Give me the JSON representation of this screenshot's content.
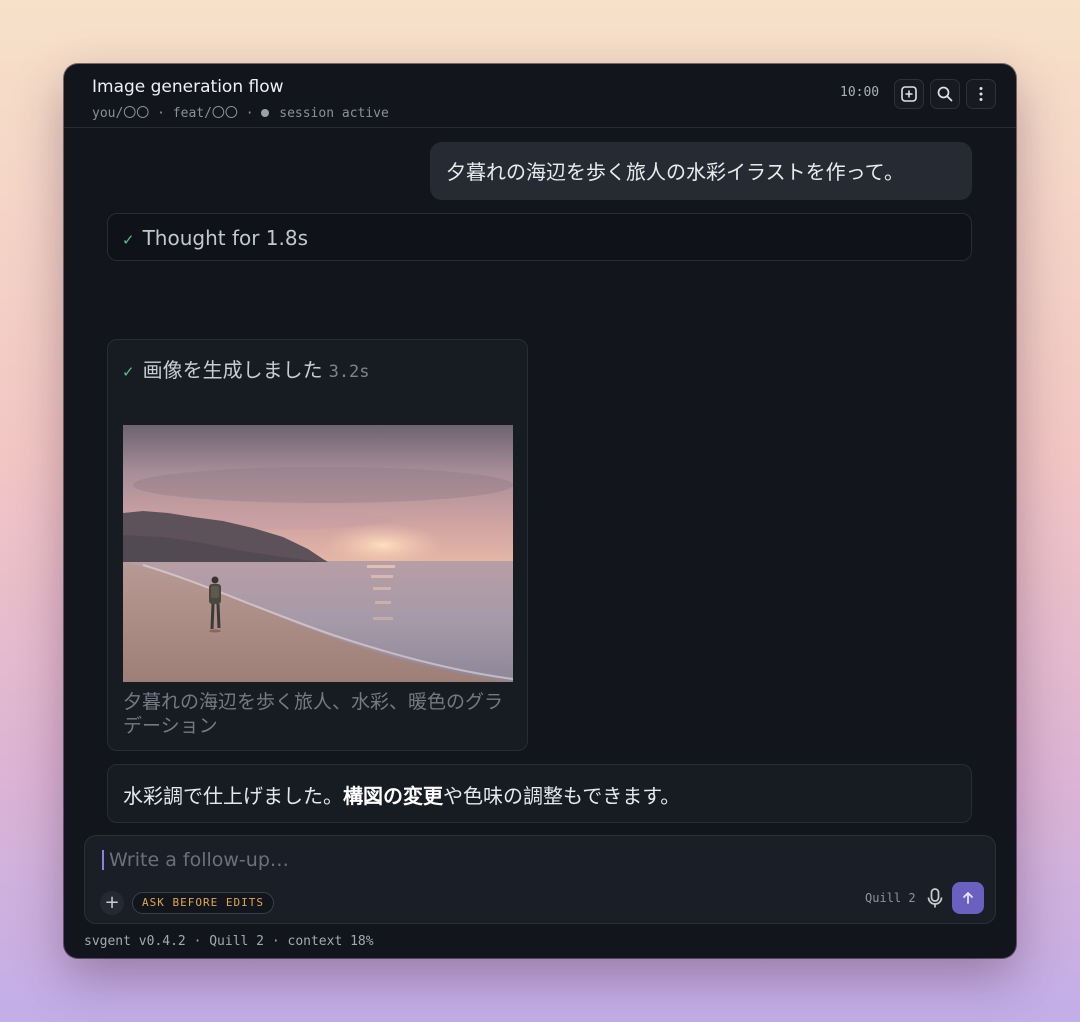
{
  "header": {
    "title": "Image generation flow",
    "branch_user": "you/〇〇",
    "branch_feat": "feat/〇〇",
    "session_status": "session active",
    "time": "10:00"
  },
  "icons": {
    "new_chat": "plus-square-icon",
    "search": "search-icon",
    "more": "more-vertical-icon",
    "check": "check-icon",
    "attach": "plus-icon",
    "mic": "microphone-icon",
    "send": "arrow-up-icon"
  },
  "conversation": {
    "user_message": "夕暮れの海辺を歩く旅人の水彩イラストを作って。",
    "thought_label": "Thought for 1.8s",
    "generation": {
      "label": "画像を生成しました",
      "duration": "3.2s",
      "caption": "夕暮れの海辺を歩く旅人、水彩、暖色のグラデーション"
    },
    "reply": {
      "before": "水彩調で仕上げました。",
      "bold": "構図の変更",
      "after": "や色味の調整もできます。"
    }
  },
  "composer": {
    "placeholder": "Write a follow-up…",
    "value": "",
    "mode_badge": "ASK BEFORE EDITS",
    "model": "Quill 2"
  },
  "footer": {
    "status": "svgent v0.4.2 · Quill 2 · context 18%"
  },
  "colors": {
    "accent": "#6b5fbf",
    "check": "#4ec48a",
    "badge_text": "#e0a84e",
    "window_bg": "#12151c"
  }
}
